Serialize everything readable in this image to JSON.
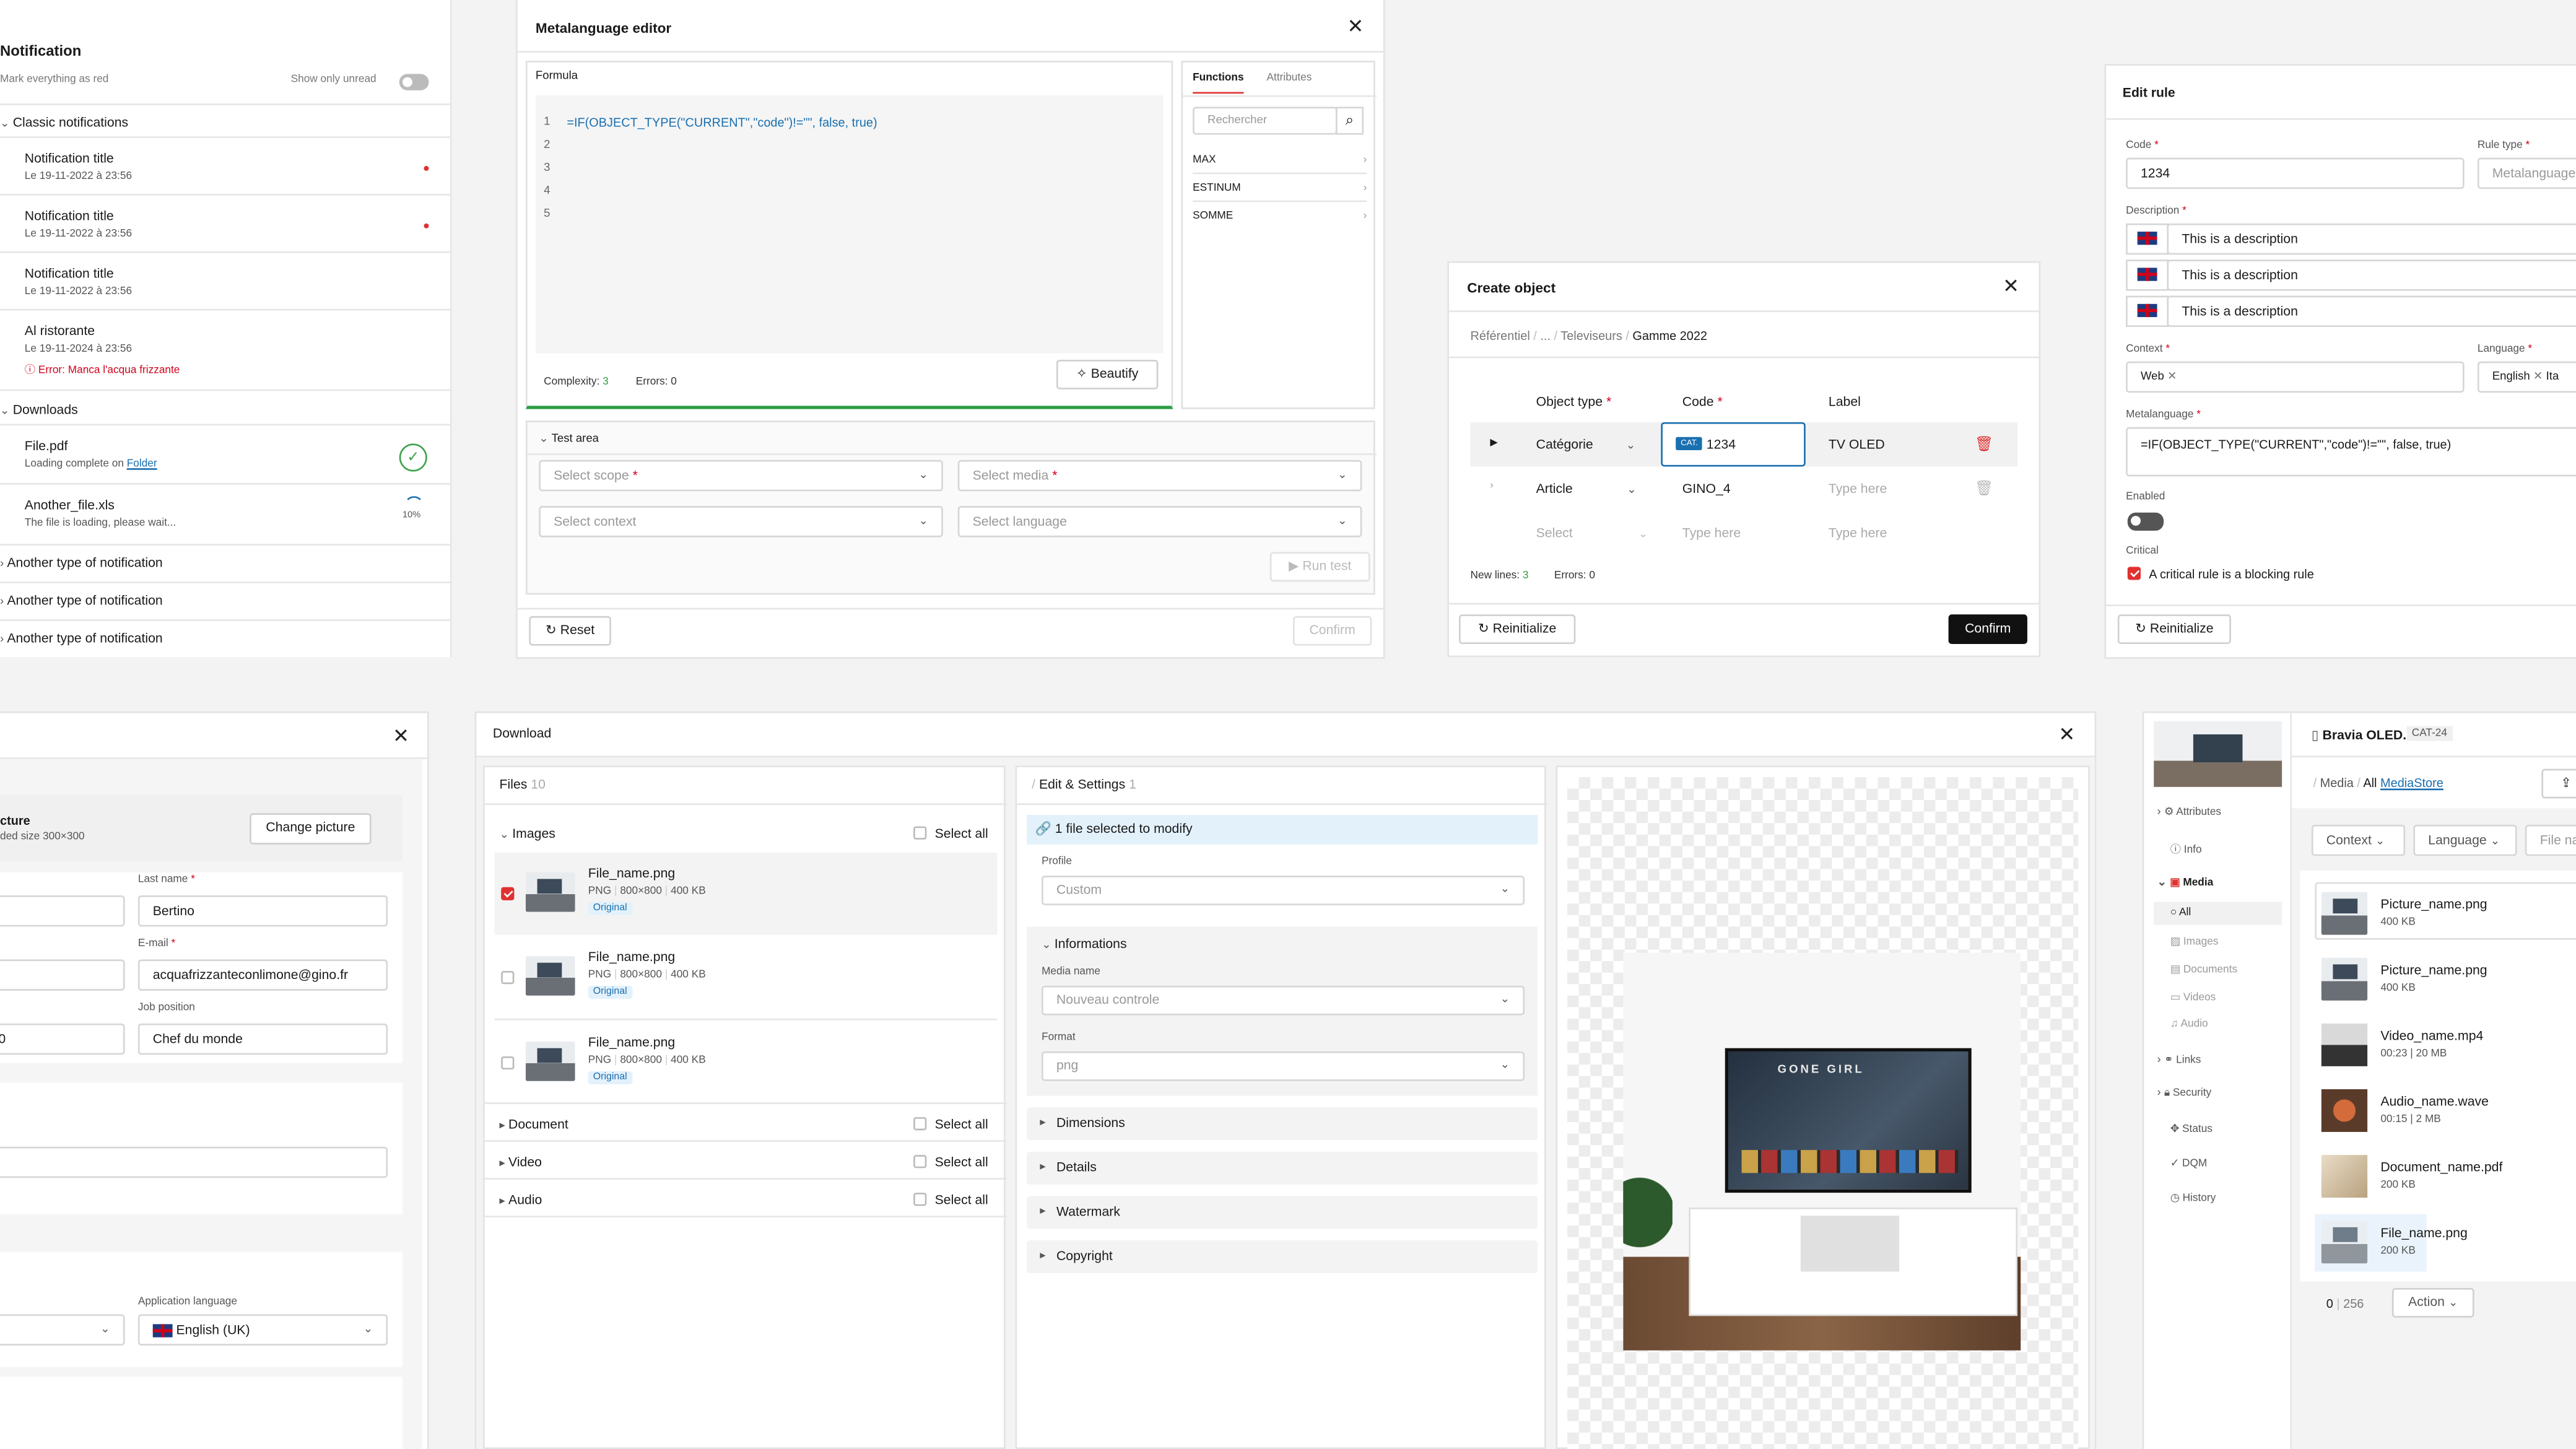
{
  "notif": {
    "title": "Notification",
    "mark_read": "Mark everything as red",
    "show_unread": "Show only unread",
    "classic": "Classic notifications",
    "items": [
      {
        "title": "Notification title",
        "date": "Le 19-11-2022 à 23:56"
      },
      {
        "title": "Notification title",
        "date": "Le 19-11-2022 à 23:56"
      },
      {
        "title": "Notification title",
        "date": "Le 19-11-2022 à 23:56"
      },
      {
        "title": "Al ristorante",
        "date": "Le 19-11-2024 à 23:56",
        "error": "Error: Manca l'acqua frizzante"
      }
    ],
    "downloads": "Downloads",
    "file1": "File.pdf",
    "file1_sub": "Loading complete on",
    "folder": "Folder",
    "file2": "Another_file.xls",
    "file2_sub": "The file is loading, please wait...",
    "pct": "10%",
    "another": "Another type of notification"
  },
  "meta": {
    "title": "Metalanguage editor",
    "formula": "Formula",
    "code": "=IF(OBJECT_TYPE(\"CURRENT\",\"code\")!=\"\", false, true)",
    "lines": [
      "1",
      "2",
      "3",
      "4",
      "5"
    ],
    "complexity_label": "Complexity:",
    "complexity": "3",
    "errors": "Errors: 0",
    "beautify": "Beautify",
    "tab_functions": "Functions",
    "tab_attributes": "Attributes",
    "search_ph": "Rechercher",
    "functions": [
      "MAX",
      "ESTINUM",
      "SOMME"
    ],
    "test_area": "Test area",
    "scope": "Select scope",
    "media": "Select media",
    "context": "Select context",
    "language": "Select language",
    "run": "Run test",
    "reset": "Reset",
    "confirm": "Confirm"
  },
  "create": {
    "title": "Create object",
    "crumbs": [
      "Référentiel",
      "...",
      "Televiseurs",
      "Gamme 2022"
    ],
    "col_type": "Object type",
    "col_code": "Code",
    "col_label": "Label",
    "r1_type": "Catégorie",
    "r1_badge": "CAT.",
    "r1_code": "1234",
    "r1_label": "TV OLED",
    "r2_type": "Article",
    "r2_code": "GINO_4",
    "type_here": "Type here",
    "select": "Select",
    "new_lines_label": "New lines:",
    "new_lines": "3",
    "errors": "Errors: 0",
    "reinit": "Reinitialize",
    "confirm": "Confirm"
  },
  "rule": {
    "title": "Edit rule",
    "code_label": "Code",
    "code": "1234",
    "type_label": "Rule type",
    "type_ph": "Metalanguage",
    "desc_label": "Description",
    "desc": "This is a description",
    "context_label": "Context",
    "context_tag": "Web",
    "lang_label": "Language",
    "lang_tag": "English",
    "lang_tag2": "Ita",
    "meta_label": "Metalanguage",
    "meta": "=IF(OBJECT_TYPE(\"CURRENT\",\"code\")!=\"\", false, true)",
    "enabled": "Enabled",
    "critical": "Critical",
    "critical_text": "A critical rule is a blocking rule",
    "reinit": "Reinitialize"
  },
  "profile": {
    "picture": "cture",
    "picture_sub": "ded size 300×300",
    "change": "Change picture",
    "last_name_label": "Last name",
    "last_name": "Bertino",
    "email_label": "E-mail",
    "email": "acquafrizzanteconlimone@gino.fr",
    "job_label": "Job position",
    "job": "Chef du monde",
    "app_lang_label": "Application language",
    "app_lang": "English (UK)",
    "left_val": "0"
  },
  "download": {
    "title": "Download",
    "files": "Files",
    "files_count": "10",
    "images": "Images",
    "select_all": "Select all",
    "file": "File_name.png",
    "meta_fmt": "PNG",
    "meta_dim": "800×800",
    "meta_size": "400 KB",
    "original": "Original",
    "sections": [
      "Document",
      "Video",
      "Audio"
    ],
    "edit": "Edit & Settings",
    "edit_count": "1",
    "selected_info": "1 file selected to modify",
    "profile": "Profile",
    "profile_val": "Custom",
    "informations": "Informations",
    "media_name": "Media name",
    "media_name_ph": "Nouveau controle",
    "format": "Format",
    "format_val": "png",
    "acc": [
      "Dimensions",
      "Details",
      "Watermark",
      "Copyright"
    ],
    "tv_title": "GONE GIRL"
  },
  "media": {
    "product": "Bravia OLED...",
    "product_code": "CAT-24",
    "tree": [
      "Attributes",
      "Info",
      "Media",
      "All",
      "Images",
      "Documents",
      "Videos",
      "Audio",
      "Links",
      "Security",
      "Status",
      "DQM",
      "History"
    ],
    "crumb_media": "Media",
    "crumb_all": "All",
    "crumb_store": "MediaStore",
    "f_context": "Context",
    "f_language": "Language",
    "f_file": "File na",
    "files": [
      {
        "name": "Picture_name.png",
        "meta": "400 KB"
      },
      {
        "name": "Picture_name.png",
        "meta": "400 KB"
      },
      {
        "name": "Video_name.mp4",
        "meta": "00:23 | 20 MB"
      },
      {
        "name": "Audio_name.wave",
        "meta": "00:15 | 2 MB"
      },
      {
        "name": "Document_name.pdf",
        "meta": "200 KB"
      },
      {
        "name": "File_name.png",
        "meta": "200 KB"
      }
    ],
    "page": "0",
    "total": "256",
    "action": "Action"
  }
}
